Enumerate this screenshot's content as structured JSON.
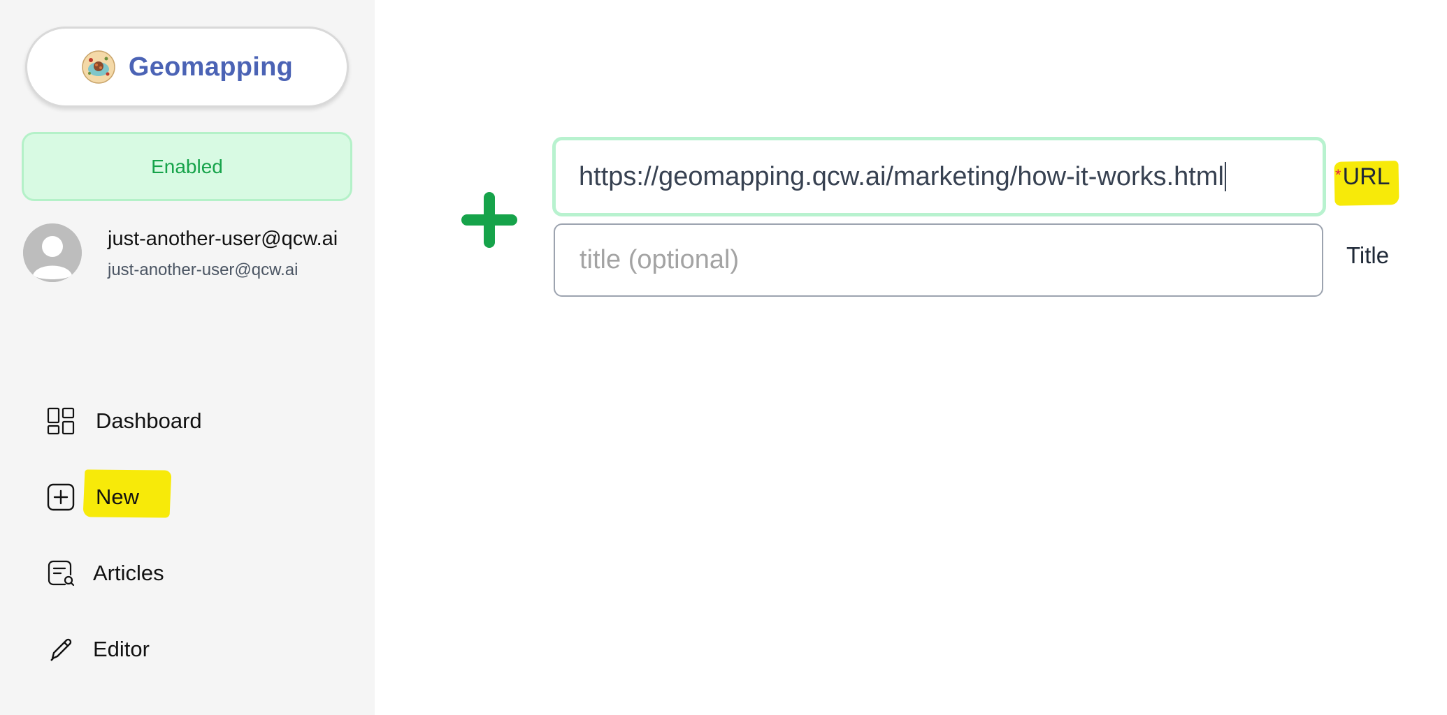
{
  "brand": {
    "name": "Geomapping",
    "logo_icon": "globe-logo-icon",
    "color": "#4b63b5"
  },
  "status": {
    "label": "Enabled",
    "color": "#16a34a",
    "background": "#d8fae3"
  },
  "user": {
    "display_name": "just-another-user@qcw.ai",
    "email": "just-another-user@qcw.ai",
    "avatar_icon": "default-avatar-icon"
  },
  "nav": {
    "items": [
      {
        "label": "Dashboard",
        "icon": "dashboard-grid-icon"
      },
      {
        "label": "New",
        "icon": "plus-square-icon",
        "highlighted": true
      },
      {
        "label": "Articles",
        "icon": "article-search-icon"
      },
      {
        "label": "Editor",
        "icon": "pencil-icon"
      }
    ]
  },
  "form": {
    "add_icon": "add-plus-icon",
    "url": {
      "value": "https://geomapping.qcw.ai/marketing/how-it-works.html",
      "label": "URL",
      "required_marker": "*",
      "highlighted": true
    },
    "title": {
      "value": "",
      "placeholder": "title (optional)",
      "label": "Title"
    }
  },
  "colors": {
    "highlight": "#f7ea09",
    "accent_green": "#16a34a",
    "focus_border": "#b8f2cf"
  }
}
